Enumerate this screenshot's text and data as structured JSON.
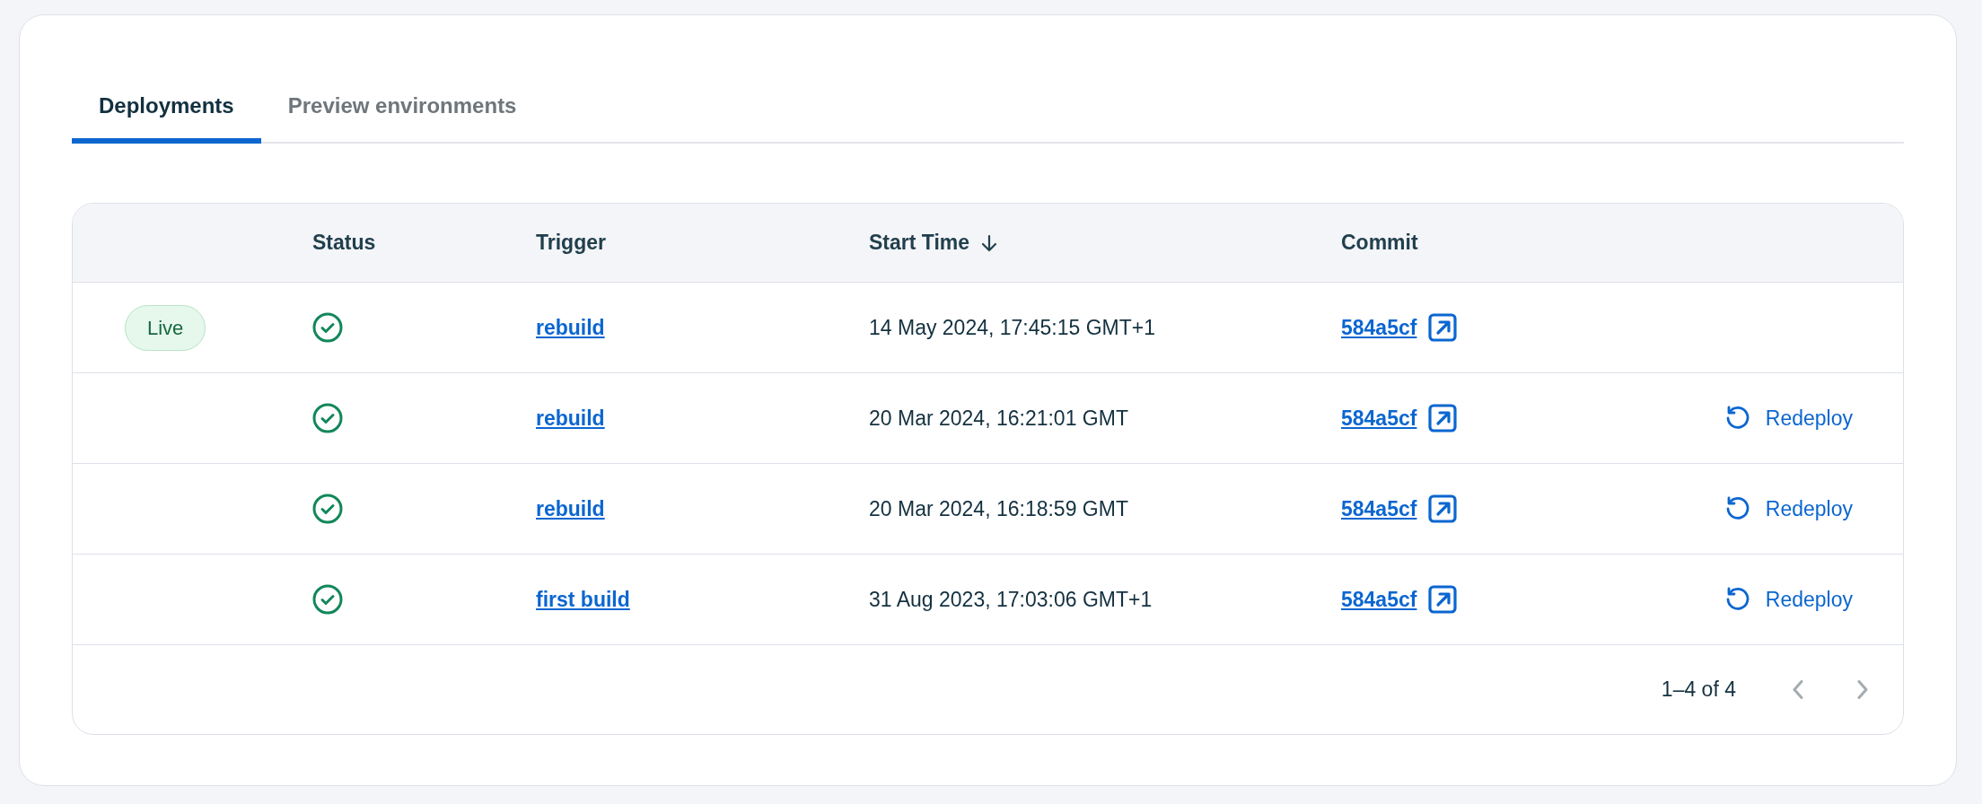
{
  "tabs": [
    {
      "label": "Deployments",
      "selected": true
    },
    {
      "label": "Preview environments",
      "selected": false
    }
  ],
  "table": {
    "columns": [
      {
        "label": "Status",
        "sorted": false
      },
      {
        "label": "Trigger",
        "sorted": false
      },
      {
        "label": "Start Time",
        "sorted": true
      },
      {
        "label": "Commit",
        "sorted": false
      }
    ],
    "rows": [
      {
        "badge": "Live",
        "succeeded": true,
        "trigger": "rebuild",
        "start_time": "14 May 2024, 17:45:15 GMT+1",
        "commit": "584a5cf"
      },
      {
        "succeeded": true,
        "trigger": "rebuild",
        "start_time": "20 Mar 2024, 16:21:01 GMT",
        "commit": "584a5cf",
        "action": "Redeploy"
      },
      {
        "succeeded": true,
        "trigger": "rebuild",
        "start_time": "20 Mar 2024, 16:18:59 GMT",
        "commit": "584a5cf",
        "action": "Redeploy"
      },
      {
        "succeeded": true,
        "trigger": "first build",
        "start_time": "31 Aug 2023, 17:03:06 GMT+1",
        "commit": "584a5cf",
        "action": "Redeploy"
      }
    ]
  },
  "pagination": {
    "range": "1–4 of 4",
    "previous_disabled": true,
    "next_disabled": true
  }
}
